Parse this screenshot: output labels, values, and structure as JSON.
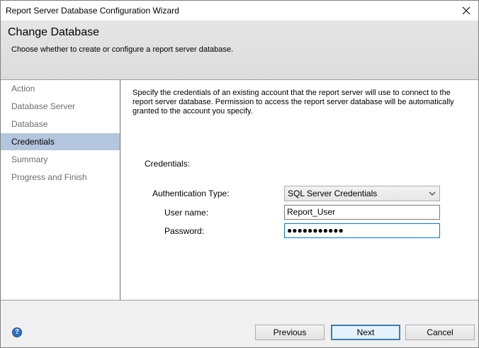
{
  "window": {
    "title": "Report Server Database Configuration Wizard"
  },
  "header": {
    "title": "Change Database",
    "subtitle": "Choose whether to create or configure a report server database."
  },
  "nav": {
    "items": [
      {
        "label": "Action",
        "active": false
      },
      {
        "label": "Database Server",
        "active": false
      },
      {
        "label": "Database",
        "active": false
      },
      {
        "label": "Credentials",
        "active": true
      },
      {
        "label": "Summary",
        "active": false
      },
      {
        "label": "Progress and Finish",
        "active": false
      }
    ]
  },
  "content": {
    "description": "Specify the credentials of an existing account that the report server will use to connect to the report server database.  Permission to access the report server database will be automatically granted to the account you specify.",
    "section_label": "Credentials:",
    "auth_type_label": "Authentication Type:",
    "auth_type_value": "SQL Server Credentials",
    "username_label": "User name:",
    "username_value": "Report_User",
    "password_label": "Password:",
    "password_value": "●●●●●●●●●●●"
  },
  "footer": {
    "help_glyph": "?",
    "previous_label": "Previous",
    "next_label": "Next",
    "cancel_label": "Cancel"
  },
  "colors": {
    "nav_active_bg": "#b3c6dd",
    "focus_border": "#0078d7",
    "help_icon": "#2f6fc0"
  }
}
